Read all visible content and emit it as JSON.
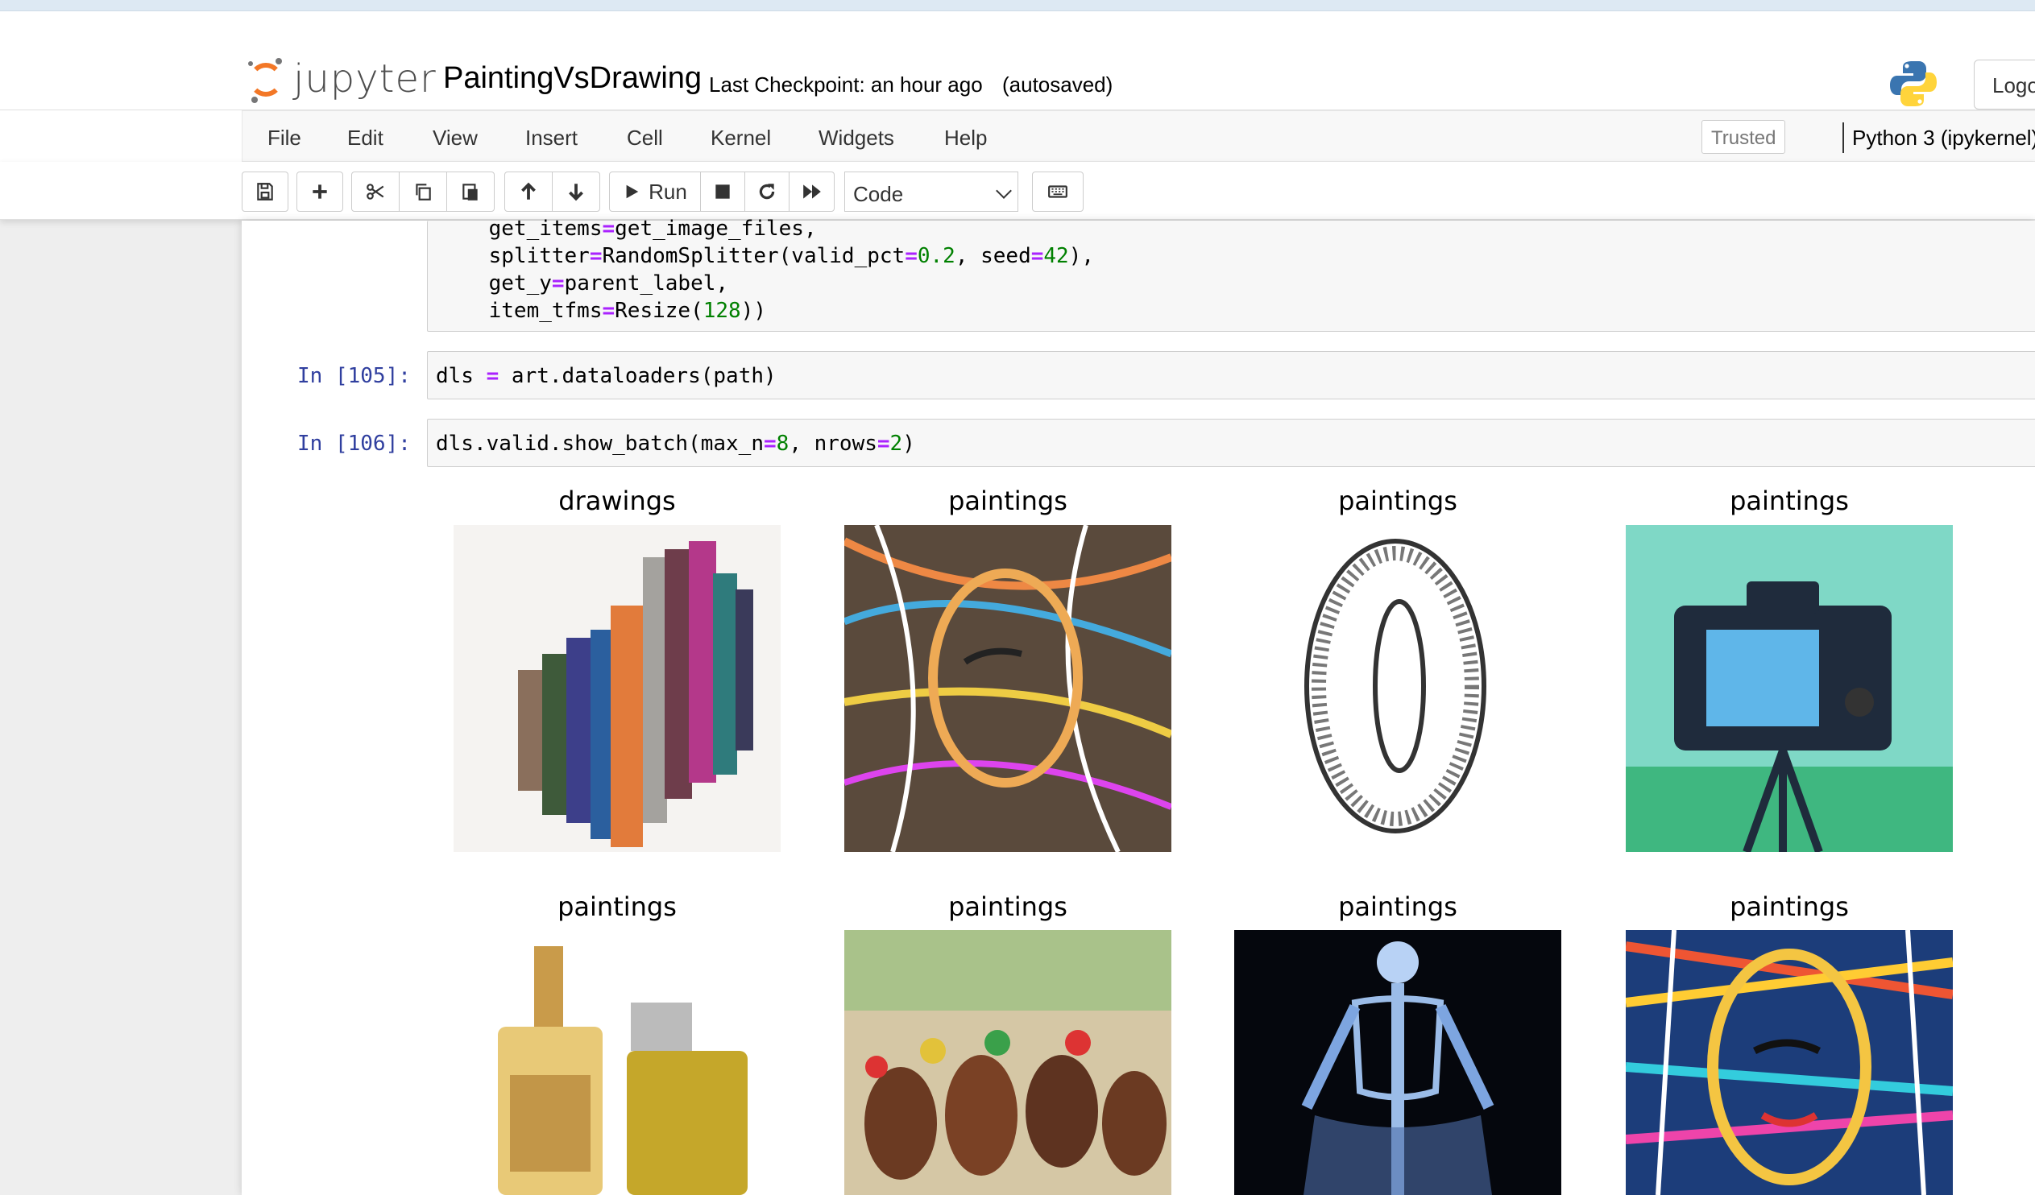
{
  "header": {
    "logo_text": "jupyter",
    "notebook_name": "PaintingVsDrawing",
    "checkpoint": "Last Checkpoint: an hour ago",
    "autosave": "(autosaved)",
    "logout_label": "Logo"
  },
  "menu": {
    "items": [
      "File",
      "Edit",
      "View",
      "Insert",
      "Cell",
      "Kernel",
      "Widgets",
      "Help"
    ],
    "trusted_label": "Trusted",
    "kernel_label": "Python 3 (ipykernel)"
  },
  "toolbar": {
    "run_label": "Run",
    "cell_type": "Code",
    "icons": [
      "save-icon",
      "plus-icon",
      "scissors-icon",
      "copy-icon",
      "paste-icon",
      "arrow-up-icon",
      "arrow-down-icon",
      "play-icon",
      "stop-icon",
      "restart-icon",
      "fast-forward-icon",
      "keyboard-icon"
    ]
  },
  "cells": {
    "prev_code_lines": [
      [
        "    get_items",
        "=",
        "get_image_files,"
      ],
      [
        "    splitter",
        "=",
        "RandomSplitter(valid_pct",
        "=",
        "0.2",
        ", seed",
        "=",
        "42",
        "),"
      ],
      [
        "    get_y",
        "=",
        "parent_label,"
      ],
      [
        "    item_tfms",
        "=",
        "Resize(",
        "128",
        "))"
      ]
    ],
    "cell105": {
      "prompt": "In [105]:",
      "code": [
        "dls ",
        "=",
        " art.dataloaders(path)"
      ]
    },
    "cell106": {
      "prompt": "In [106]:",
      "code": [
        "dls.valid.show_batch(max_n",
        "=",
        "8",
        ", nrows",
        "=",
        "2",
        ")"
      ]
    }
  },
  "batch": {
    "labels": [
      "drawings",
      "paintings",
      "paintings",
      "paintings",
      "paintings",
      "paintings",
      "paintings",
      "paintings"
    ],
    "thumbnails": [
      "makeup-swatch-image",
      "abstract-portrait-image",
      "zero-sketch-image",
      "camera-illustration-image",
      "perfume-bottles-image",
      "horse-race-image",
      "xray-skeleton-image",
      "colorful-portrait-image"
    ]
  },
  "colors": {
    "prompt": "#303f9f",
    "operator": "#aa22ff",
    "number": "#008000",
    "jupyter_orange": "#f37726"
  }
}
